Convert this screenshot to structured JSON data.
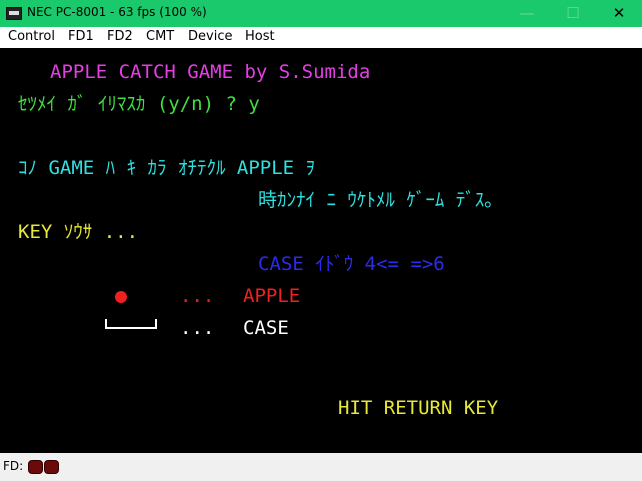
{
  "window": {
    "title": "NEC PC-8001 - 63 fps (100 %)",
    "controls": {
      "minimize": "—",
      "maximize": "☐",
      "close": "✕"
    }
  },
  "menu": {
    "items": [
      "Control",
      "FD1",
      "FD2",
      "CMT",
      "Device",
      "Host"
    ]
  },
  "screen": {
    "lines": {
      "title": "APPLE CATCH GAME by S.Sumida",
      "prompt": "ｾﾂﾒｲ ｶﾞ ｲﾘﾏｽｶ (y/n) ? y",
      "desc1": "ｺﾉ GAME ﾊ ｷ ｶﾗ ｵﾁﾃｸﾙ APPLE ｦ",
      "desc2": "時ｶﾝﾅｲ ﾆ ｳｹﾄﾒﾙ ｹﾞｰﾑ ﾃﾞｽ｡",
      "key_header": "KEY ｿｳｻ ...",
      "case_move": "CASE ｲﾄﾞｳ 4<= =>6",
      "apple_dots": "...",
      "apple_label": "APPLE",
      "case_dots": "...",
      "case_label": "CASE",
      "hit_return": "HIT RETURN KEY"
    },
    "colors": {
      "background": "#000000",
      "magenta": "#e43ee4",
      "green": "#3fe03f",
      "cyan": "#2ee0e0",
      "yellow": "#e8e83a",
      "blue": "#2b2bf0",
      "red": "#f02020",
      "white": "#ffffff"
    }
  },
  "status": {
    "fd_label": "FD:",
    "fd_led_icons": [
      "fd1-led-icon",
      "fd2-led-icon"
    ]
  }
}
